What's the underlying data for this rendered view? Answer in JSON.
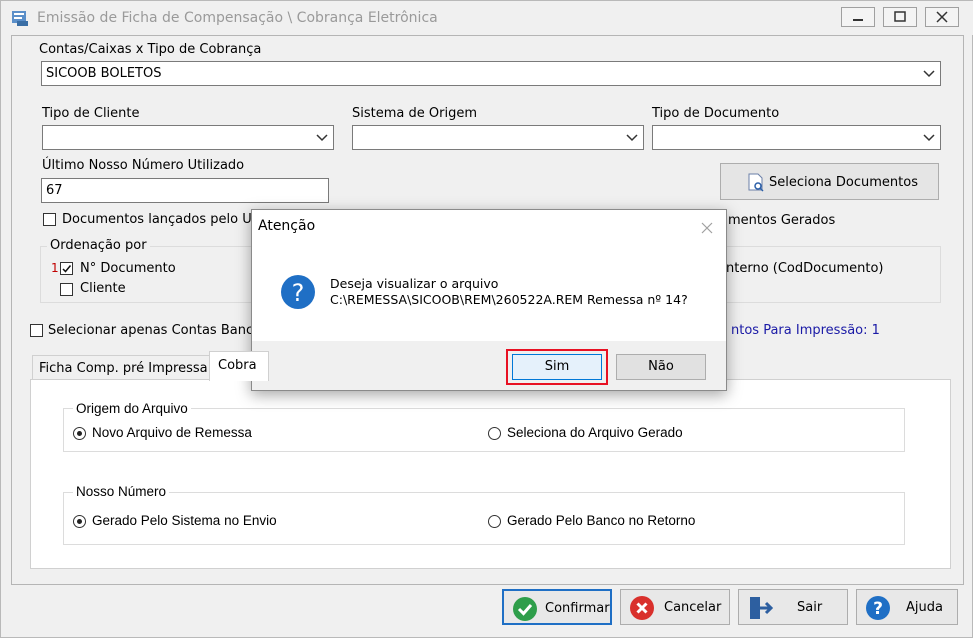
{
  "window": {
    "title": "Emissão de Ficha de Compensação \\ Cobrança Eletrônica"
  },
  "contas": {
    "label": "Contas/Caixas x Tipo de Cobrança",
    "value": "SICOOB  BOLETOS"
  },
  "tipo_cliente": {
    "label": "Tipo de Cliente",
    "value": ""
  },
  "sistema_origem": {
    "label": "Sistema de Origem",
    "value": ""
  },
  "tipo_documento": {
    "label": "Tipo de Documento",
    "value": ""
  },
  "ultimo_nosso_numero": {
    "label": "Último Nosso Número Utilizado",
    "value": "67"
  },
  "seleciona_documentos": {
    "label": "Seleciona Documentos"
  },
  "docs_lancados": {
    "label": "Documentos lançados pelo U",
    "checked": false
  },
  "docs_gerados": {
    "label": "mentos Gerados"
  },
  "ordenacao": {
    "title": "Ordenação por",
    "index": "1",
    "items": [
      {
        "label": "N° Documento",
        "checked": true
      },
      {
        "label": "Cliente",
        "checked": false
      }
    ],
    "interno_label": "nterno (CodDocumento)"
  },
  "selecionar_contas": {
    "label": "Selecionar apenas Contas Bancá",
    "checked": false
  },
  "docs_impressao": {
    "label": "ntos Para Impressão: 1",
    "color": "#1a1aa6"
  },
  "tabs": [
    {
      "label": "Ficha Comp. pré Impressa"
    },
    {
      "label": "Cobra"
    }
  ],
  "origem_arquivo": {
    "title": "Origem do Arquivo",
    "options": [
      {
        "label": "Novo Arquivo de Remessa",
        "selected": true
      },
      {
        "label": "Seleciona do Arquivo Gerado",
        "selected": false
      }
    ]
  },
  "nosso_numero": {
    "title": "Nosso Número",
    "options": [
      {
        "label": "Gerado Pelo Sistema no Envio",
        "selected": true
      },
      {
        "label": "Gerado Pelo Banco  no Retorno",
        "selected": false
      }
    ]
  },
  "footer": {
    "confirmar": "Confirmar",
    "cancelar": "Cancelar",
    "sair": "Sair",
    "ajuda": "Ajuda"
  },
  "dialog": {
    "title": "Atenção",
    "line1": "Deseja visualizar o arquivo",
    "line2": "C:\\REMESSA\\SICOOB\\REM\\260522A.REM Remessa nº 14?",
    "sim": "Sim",
    "nao": "Não",
    "highlight_color": "#e81123",
    "icon": "question-icon"
  },
  "colors": {
    "accent_blue": "#1f6fc5",
    "confirm_green": "#2e9e4a",
    "cancel_red": "#d9302c"
  }
}
